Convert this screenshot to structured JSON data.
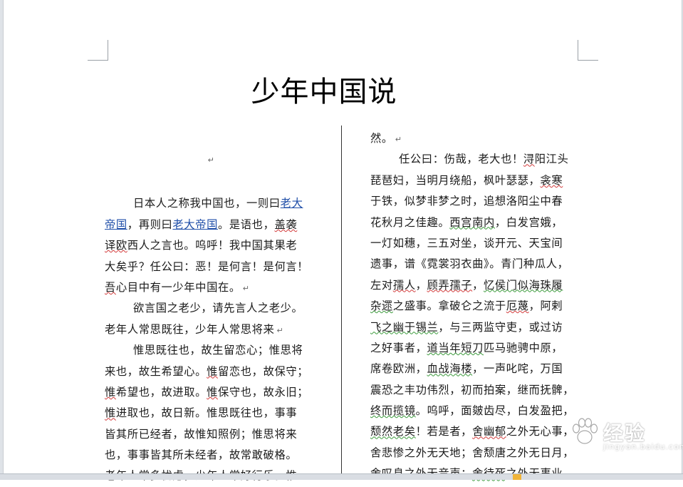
{
  "title": "少年中国说",
  "left_column": {
    "empty_mark": "↵",
    "p1": {
      "l1_a": "日本人之称我中国也，一则曰",
      "l1_link": "老大",
      "l2_link": "帝国",
      "l2_b": "，再则曰",
      "l2_link2": "老大帝国",
      "l2_c": "。是语也，",
      "l2_sq": "盖袭",
      "l3_sq": "译欧",
      "l3_b": "西人之言也。呜呼！我中国其果老",
      "l4": "大矣乎？任公曰：恶！是何言！是何言！",
      "l5_sq": "吾",
      "l5_b": "心目中有一少年中国在。",
      "l5_mark": "↵"
    },
    "p2": {
      "l1": "欲言国之老少，请先言人之老少。",
      "l2": "老年人常思既往，少年人常思将来",
      "l2_mark": "↵"
    },
    "p3": {
      "l1": "惟思既往也，故生留恋心；惟思将",
      "l2_a": "来也，故生希望心。",
      "l2_sq": "惟",
      "l2_b": "留恋也，故保守；",
      "l3_sq": "惟",
      "l3_a": "希望也，故进取。",
      "l3_sq2": "惟",
      "l3_b": "保守也，故永旧；",
      "l4_sq": "惟",
      "l4_b": "进取也，故日新。惟思既往也，事事",
      "l5": "皆其所已经者，故惟知照例；惟思将来",
      "l6": "也，事事皆其所未经者，故常敢破格。",
      "l7": "老年人常多忧虑，少年人常好行乐。惟"
    }
  },
  "right_column": {
    "l0": "然。",
    "l0_mark": "↵",
    "l1_a": "任公曰：伤哉，老大也！",
    "l1_sq": "浔",
    "l1_b": "阳江头",
    "l2_a": "琵琶妇，当明月绕船，枫叶瑟瑟，",
    "l2_sq": "衾寒",
    "l3": "于铁，似梦非梦之时，追想洛阳尘中春",
    "l4_a": "花秋月之佳趣。",
    "l4_sq": "西宫南内",
    "l4_b": "，白发宫娥，",
    "l5": "一灯如穗，三五对坐，谈开元、天宝间",
    "l6": "遗事，谱《霓裳羽衣曲》。青门种瓜人，",
    "l7_a": "左对",
    "l7_sq": "孺人",
    "l7_b": "，",
    "l7_sq2": "顾弄孺子",
    "l7_c": "，",
    "l7_sq3": "忆侯门似海珠履",
    "l8_sq": "杂遝",
    "l8_b": "之盛事。拿破仑之流于",
    "l8_sq2": "厄蔑",
    "l8_c": "，阿剌",
    "l9_sq": "飞之幽于锡兰",
    "l9_b": "，与三两监守吏，或过访",
    "l10_a": "之好事者，",
    "l10_sq": "道当年短刀",
    "l10_b": "匹马驰骋中原，",
    "l11_a": "席卷欧洲，",
    "l11_sq": "血战海楼",
    "l11_b": "，一声叱咤，万国",
    "l12": "震恐之丰功伟烈，初而拍案，继而抚髀，",
    "l13_sq": "终而揽镜",
    "l13_b": "。呜呼，面皴齿尽，白发盈把，",
    "l14_sq": "颓然老矣",
    "l14_b": "！若是者，",
    "l14_sq2": "舍幽郁",
    "l14_c": "之外无心事，",
    "l15": "舍悲惨之外无天地；舍颓唐之外无日月，",
    "l16_a": "舍叹息之外无音声；",
    "l16_sq": "舍待死",
    "l16_b": "之外无事业。"
  },
  "watermark": {
    "text": "经验",
    "sub": "jingyan.baidu.com"
  }
}
